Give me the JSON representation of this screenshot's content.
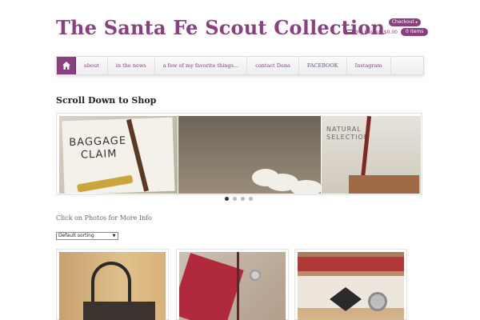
{
  "site": {
    "title": "The Santa Fe Scout Collection"
  },
  "cart": {
    "checkout_label": "Checkout",
    "checkout_arrow": "▸",
    "basket_label": "My Basket: $0.00",
    "items_label": "0 items"
  },
  "nav": {
    "home_icon": "home-icon",
    "items": [
      {
        "label": "about"
      },
      {
        "label": "in the news"
      },
      {
        "label": "a few of my favorite things..."
      },
      {
        "label": "contact Dana"
      },
      {
        "label": "FACEBOOK"
      },
      {
        "label": "Instagram"
      }
    ]
  },
  "main": {
    "heading": "Scroll Down to Shop",
    "click_info": "Click on Photos for More Info",
    "sort": {
      "selected": "Default sorting"
    }
  },
  "slider": {
    "slide1_line1": "BAGGAGE",
    "slide1_line2": "CLAIM",
    "slide3_line1": "NATURAL",
    "slide3_line2": "SELECTION",
    "dots_total": 4,
    "active_dot": 1
  },
  "colors": {
    "brand": "#8a3f7e",
    "nav_bg": "#f2f2f2"
  }
}
